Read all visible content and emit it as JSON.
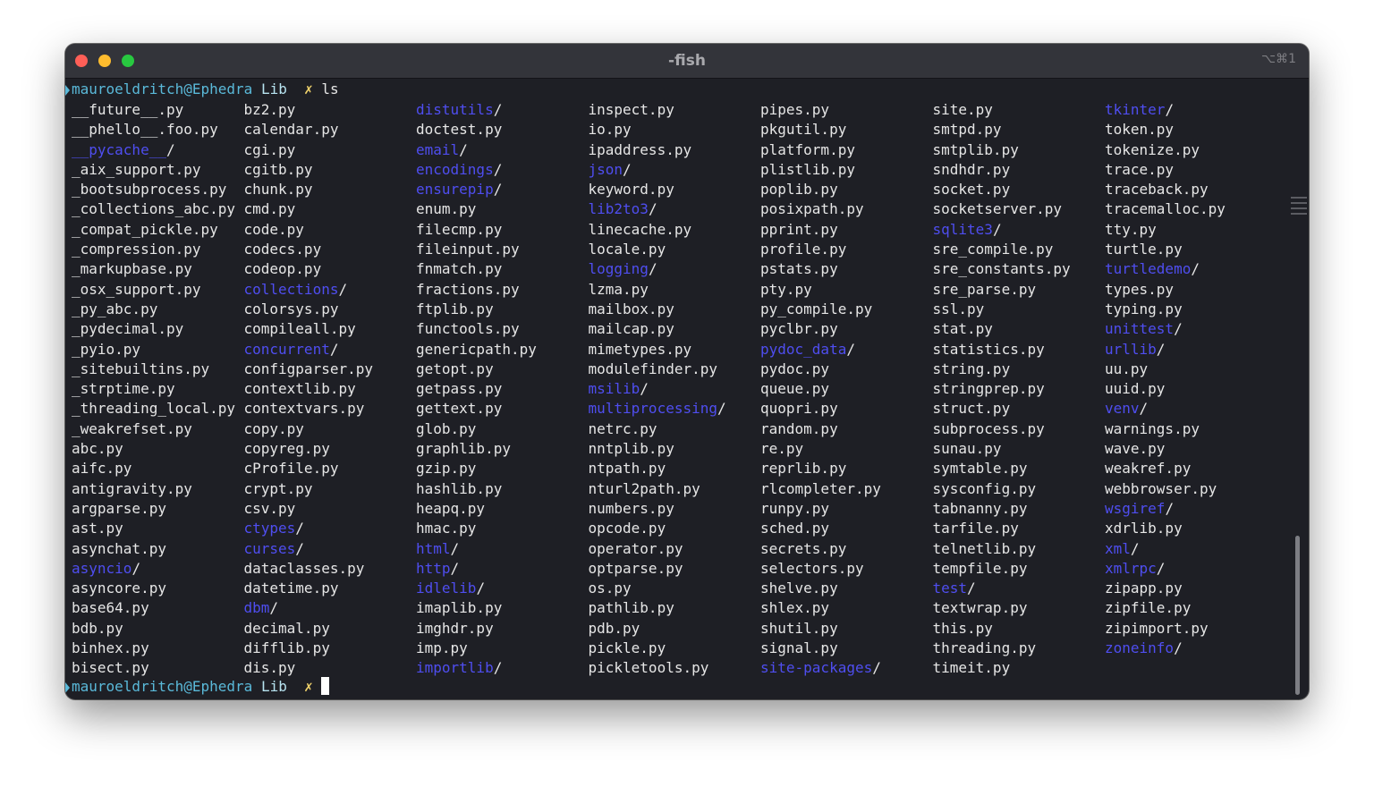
{
  "window": {
    "title": "-fish",
    "shortcut": "⌥⌘1"
  },
  "prompt": {
    "user": "mauroeldritch@Ephedra",
    "dir": "Lib",
    "symbol": "✗",
    "command": "ls"
  },
  "listing": [
    [
      "__future__.py",
      "__phello__.foo.py",
      "__pycache__/",
      "_aix_support.py",
      "_bootsubprocess.py",
      "_collections_abc.py",
      "_compat_pickle.py",
      "_compression.py",
      "_markupbase.py",
      "_osx_support.py",
      "_py_abc.py",
      "_pydecimal.py",
      "_pyio.py",
      "_sitebuiltins.py",
      "_strptime.py",
      "_threading_local.py",
      "_weakrefset.py",
      "abc.py",
      "aifc.py",
      "antigravity.py",
      "argparse.py",
      "ast.py",
      "asynchat.py",
      "asyncio/",
      "asyncore.py",
      "base64.py",
      "bdb.py",
      "binhex.py",
      "bisect.py"
    ],
    [
      "bz2.py",
      "calendar.py",
      "cgi.py",
      "cgitb.py",
      "chunk.py",
      "cmd.py",
      "code.py",
      "codecs.py",
      "codeop.py",
      "collections/",
      "colorsys.py",
      "compileall.py",
      "concurrent/",
      "configparser.py",
      "contextlib.py",
      "contextvars.py",
      "copy.py",
      "copyreg.py",
      "cProfile.py",
      "crypt.py",
      "csv.py",
      "ctypes/",
      "curses/",
      "dataclasses.py",
      "datetime.py",
      "dbm/",
      "decimal.py",
      "difflib.py",
      "dis.py"
    ],
    [
      "distutils/",
      "doctest.py",
      "email/",
      "encodings/",
      "ensurepip/",
      "enum.py",
      "filecmp.py",
      "fileinput.py",
      "fnmatch.py",
      "fractions.py",
      "ftplib.py",
      "functools.py",
      "genericpath.py",
      "getopt.py",
      "getpass.py",
      "gettext.py",
      "glob.py",
      "graphlib.py",
      "gzip.py",
      "hashlib.py",
      "heapq.py",
      "hmac.py",
      "html/",
      "http/",
      "idlelib/",
      "imaplib.py",
      "imghdr.py",
      "imp.py",
      "importlib/"
    ],
    [
      "inspect.py",
      "io.py",
      "ipaddress.py",
      "json/",
      "keyword.py",
      "lib2to3/",
      "linecache.py",
      "locale.py",
      "logging/",
      "lzma.py",
      "mailbox.py",
      "mailcap.py",
      "mimetypes.py",
      "modulefinder.py",
      "msilib/",
      "multiprocessing/",
      "netrc.py",
      "nntplib.py",
      "ntpath.py",
      "nturl2path.py",
      "numbers.py",
      "opcode.py",
      "operator.py",
      "optparse.py",
      "os.py",
      "pathlib.py",
      "pdb.py",
      "pickle.py",
      "pickletools.py"
    ],
    [
      "pipes.py",
      "pkgutil.py",
      "platform.py",
      "plistlib.py",
      "poplib.py",
      "posixpath.py",
      "pprint.py",
      "profile.py",
      "pstats.py",
      "pty.py",
      "py_compile.py",
      "pyclbr.py",
      "pydoc_data/",
      "pydoc.py",
      "queue.py",
      "quopri.py",
      "random.py",
      "re.py",
      "reprlib.py",
      "rlcompleter.py",
      "runpy.py",
      "sched.py",
      "secrets.py",
      "selectors.py",
      "shelve.py",
      "shlex.py",
      "shutil.py",
      "signal.py",
      "site-packages/"
    ],
    [
      "site.py",
      "smtpd.py",
      "smtplib.py",
      "sndhdr.py",
      "socket.py",
      "socketserver.py",
      "sqlite3/",
      "sre_compile.py",
      "sre_constants.py",
      "sre_parse.py",
      "ssl.py",
      "stat.py",
      "statistics.py",
      "string.py",
      "stringprep.py",
      "struct.py",
      "subprocess.py",
      "sunau.py",
      "symtable.py",
      "sysconfig.py",
      "tabnanny.py",
      "tarfile.py",
      "telnetlib.py",
      "tempfile.py",
      "test/",
      "textwrap.py",
      "this.py",
      "threading.py",
      "timeit.py"
    ],
    [
      "tkinter/",
      "token.py",
      "tokenize.py",
      "trace.py",
      "traceback.py",
      "tracemalloc.py",
      "tty.py",
      "turtle.py",
      "turtledemo/",
      "types.py",
      "typing.py",
      "unittest/",
      "urllib/",
      "uu.py",
      "uuid.py",
      "venv/",
      "warnings.py",
      "wave.py",
      "weakref.py",
      "webbrowser.py",
      "wsgiref/",
      "xdrlib.py",
      "xml/",
      "xmlrpc/",
      "zipapp.py",
      "zipfile.py",
      "zipimport.py",
      "zoneinfo/"
    ]
  ],
  "colors": {
    "folder": "#4f4ef0",
    "user": "#5ab9d9",
    "prompt_symbol": "#f1d36c",
    "background": "#1e1f25"
  }
}
